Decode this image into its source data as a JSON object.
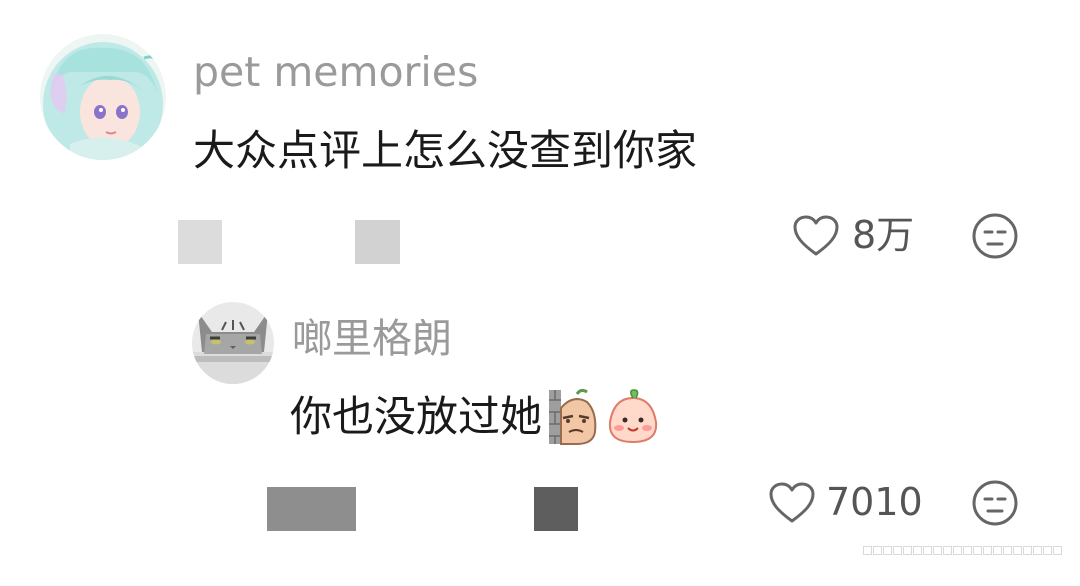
{
  "comments": [
    {
      "username": "pet memories",
      "text": "大众点评上怎么没查到你家",
      "like_count": "8万"
    },
    {
      "username": "啷里格朗",
      "text": "你也没放过她",
      "like_count": "7010"
    }
  ],
  "icons": {
    "like": "heart-outline-icon",
    "reaction": "expressionless-face-icon",
    "stickers": [
      "sticker-peeking-wall-icon",
      "sticker-blushing-peach-icon"
    ]
  },
  "colors": {
    "username": "#9a9a9a",
    "text": "#1a1a1a",
    "count": "#555555",
    "icon": "#666666",
    "redacted_light": "#dcdcdc",
    "redacted_dark": "#8e8e8e"
  }
}
